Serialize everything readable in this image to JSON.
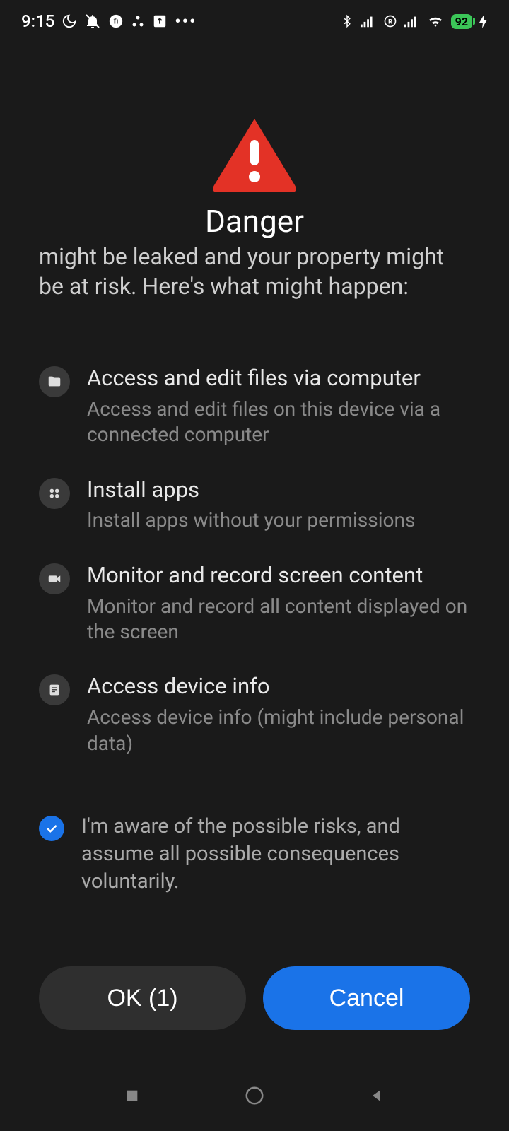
{
  "status": {
    "time": "9:15",
    "battery_level": "92"
  },
  "dialog": {
    "title": "Danger",
    "body_text": "might be leaked and your property might be at risk. Here's what might happen:"
  },
  "risks": [
    {
      "icon": "folder-icon",
      "title": "Access and edit files via computer",
      "desc": "Access and edit files on this device via a connected computer"
    },
    {
      "icon": "apps-icon",
      "title": "Install apps",
      "desc": "Install apps without your permissions"
    },
    {
      "icon": "camera-icon",
      "title": "Monitor and record screen content",
      "desc": "Monitor and record all content displayed on the screen"
    },
    {
      "icon": "doc-icon",
      "title": "Access device info",
      "desc": "Access device info (might include personal data)"
    }
  ],
  "checkbox": {
    "label": "I'm aware of the possible risks, and assume all possible consequences voluntarily.",
    "checked": true
  },
  "buttons": {
    "ok_label": "OK (1)",
    "cancel_label": "Cancel"
  }
}
